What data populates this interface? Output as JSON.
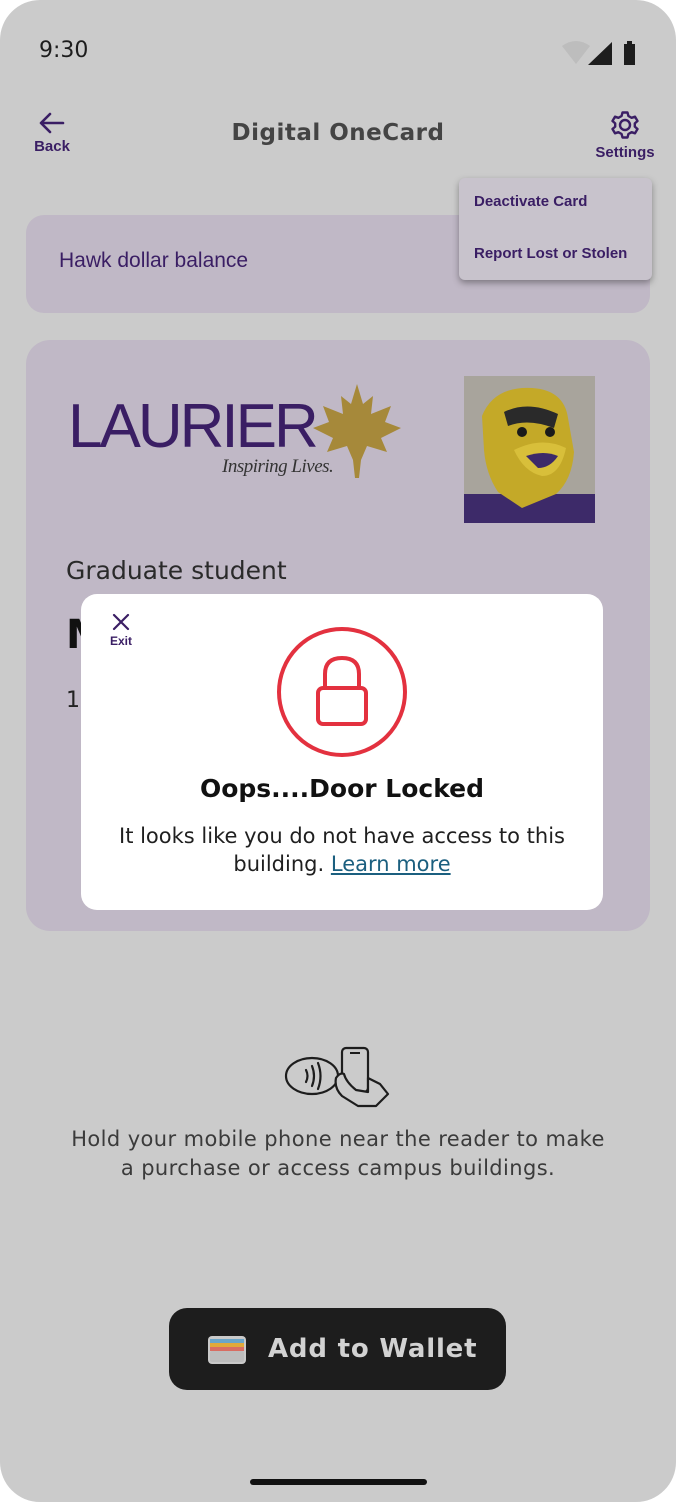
{
  "status_bar": {
    "time": "9:30"
  },
  "app_bar": {
    "title": "Digital OneCard",
    "back_label": "Back",
    "settings_label": "Settings"
  },
  "settings_menu": {
    "items": [
      "Deactivate Card",
      "Report Lost or Stolen"
    ]
  },
  "balance": {
    "label": "Hawk dollar balance"
  },
  "id_card": {
    "logo_text": "LAURIER",
    "logo_tagline": "Inspiring Lives.",
    "role": "Graduate student",
    "name_initial": "M",
    "id_prefix": "1"
  },
  "modal": {
    "exit_label": "Exit",
    "title": "Oops....Door Locked",
    "body": "It looks like you do not have access to this building.",
    "link_label": "Learn more"
  },
  "hint": {
    "line1": "Hold your mobile phone near the reader to make",
    "line2": "a purchase or access campus buildings."
  },
  "wallet_button": {
    "label": "Add to Wallet"
  },
  "colors": {
    "brand_purple": "#3a1e64",
    "lock_red": "#e3313f",
    "link_teal": "#1b5f7f",
    "overlay_gray": "#cbcbcb"
  }
}
